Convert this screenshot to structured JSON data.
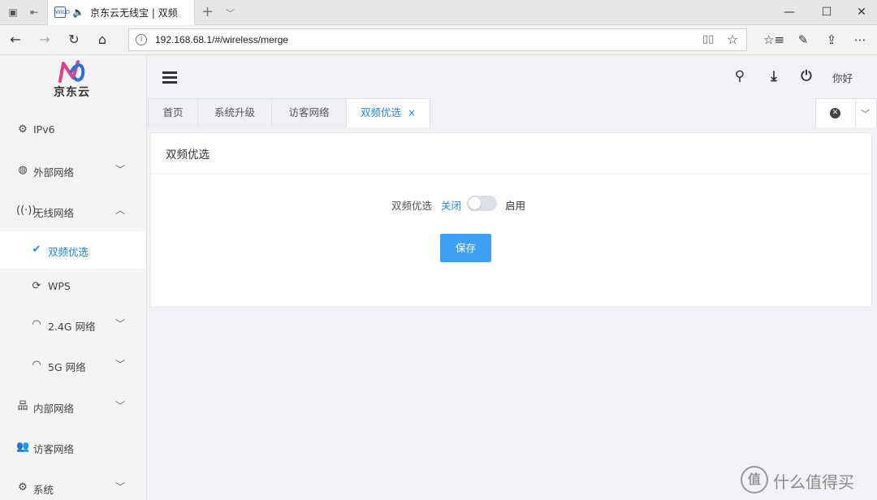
{
  "browser": {
    "tab_title": "京东云无线宝 | 双频",
    "tab_audio_icon": "speaker-icon",
    "favicon_text": "WiLD",
    "new_tab_glyph": "+",
    "url": "192.168.68.1/#/wireless/merge",
    "window_buttons": [
      "—",
      "☐",
      "✕"
    ]
  },
  "sidebar": {
    "logo_text": "京东云",
    "items": [
      {
        "label": "IPv6",
        "icon": "settings-cog-icon"
      },
      {
        "label": "外部网络",
        "icon": "globe-icon"
      },
      {
        "label": "无线网络",
        "icon": "wireless-antenna-icon"
      },
      {
        "label": "双频优选",
        "icon": "double-check-icon"
      },
      {
        "label": "WPS",
        "icon": "sync-icon"
      },
      {
        "label": "2.4G 网络",
        "icon": "wifi-icon"
      },
      {
        "label": "5G 网络",
        "icon": "wifi-icon"
      },
      {
        "label": "内部网络",
        "icon": "lan-network-icon"
      },
      {
        "label": "访客网络",
        "icon": "users-icon"
      },
      {
        "label": "系统",
        "icon": "cogs-icon"
      }
    ]
  },
  "header": {
    "user_label": "你好"
  },
  "page_tabs": [
    {
      "label": "首页"
    },
    {
      "label": "系统升级"
    },
    {
      "label": "访客网络"
    },
    {
      "label": "双频优选",
      "active": true,
      "close": "×"
    }
  ],
  "card": {
    "title": "双频优选",
    "field_label": "双频优选",
    "off_label": "关闭",
    "on_label": "启用",
    "toggle_on": false,
    "save_label": "保存"
  },
  "watermark": {
    "icon_text": "值",
    "text": "什么值得买"
  },
  "colors": {
    "accent": "#1e87f0",
    "button": "#3ea0f5",
    "sidebar_bg": "#f4f4f4",
    "content_bg": "#f0f2f5"
  }
}
